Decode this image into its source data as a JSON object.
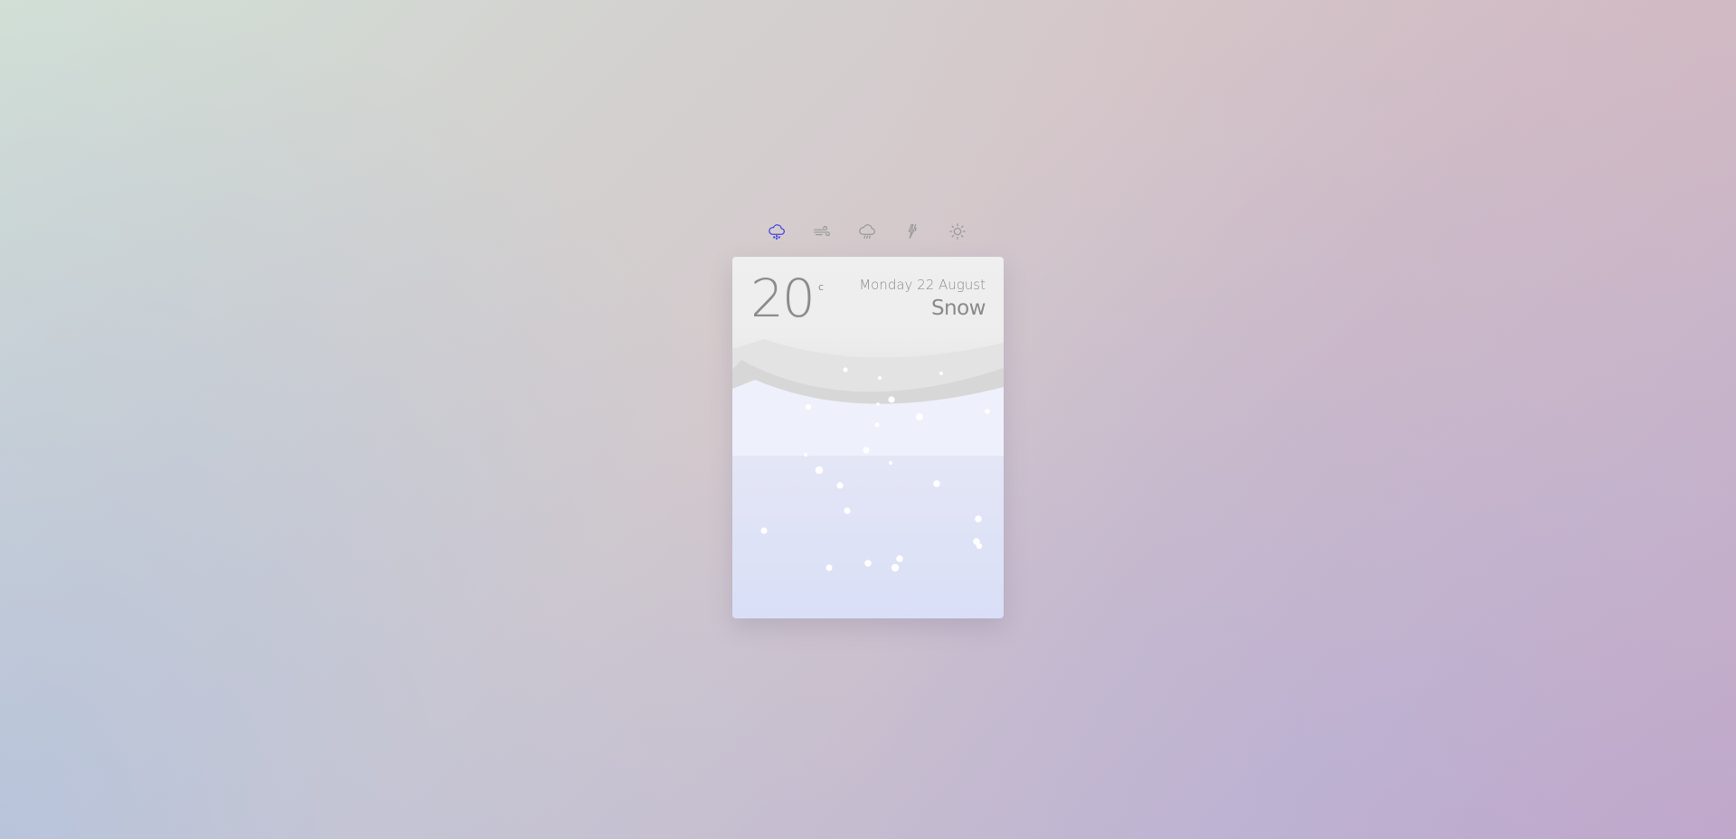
{
  "weather_nav": {
    "items": [
      {
        "icon": "snow-cloud-icon",
        "active": true,
        "color": "#4a48e0"
      },
      {
        "icon": "wind-icon",
        "active": false,
        "color": "#9b9b9b"
      },
      {
        "icon": "rain-cloud-icon",
        "active": false,
        "color": "#9b9b9b"
      },
      {
        "icon": "lightning-icon",
        "active": false,
        "color": "#9b9b9b"
      },
      {
        "icon": "sun-icon",
        "active": false,
        "color": "#9b9b9b"
      }
    ]
  },
  "card": {
    "temperature": "20",
    "unit": "c",
    "date": "Monday 22 August",
    "summary": "Snow"
  }
}
